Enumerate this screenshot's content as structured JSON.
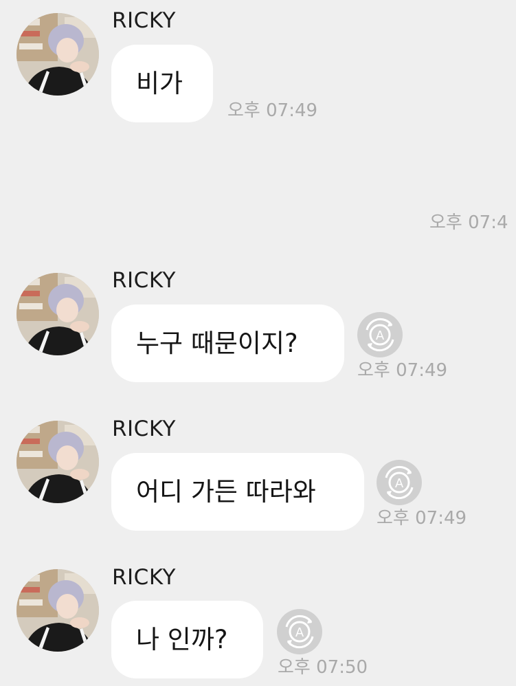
{
  "messages": [
    {
      "sender": "RICKY",
      "text": "비가",
      "time": "오후 07:49"
    },
    {
      "sender": "RICKY",
      "text": "누구 때문이지?",
      "time": "오후 07:49"
    },
    {
      "sender": "RICKY",
      "text": "어디 가든 따라와",
      "time": "오후 07:49"
    },
    {
      "sender": "RICKY",
      "text": "나 인까?",
      "time": "오후 07:50"
    }
  ],
  "outgoing_time": "오후 07:4",
  "icons": {
    "translate": "translate-icon",
    "avatar": "avatar"
  }
}
